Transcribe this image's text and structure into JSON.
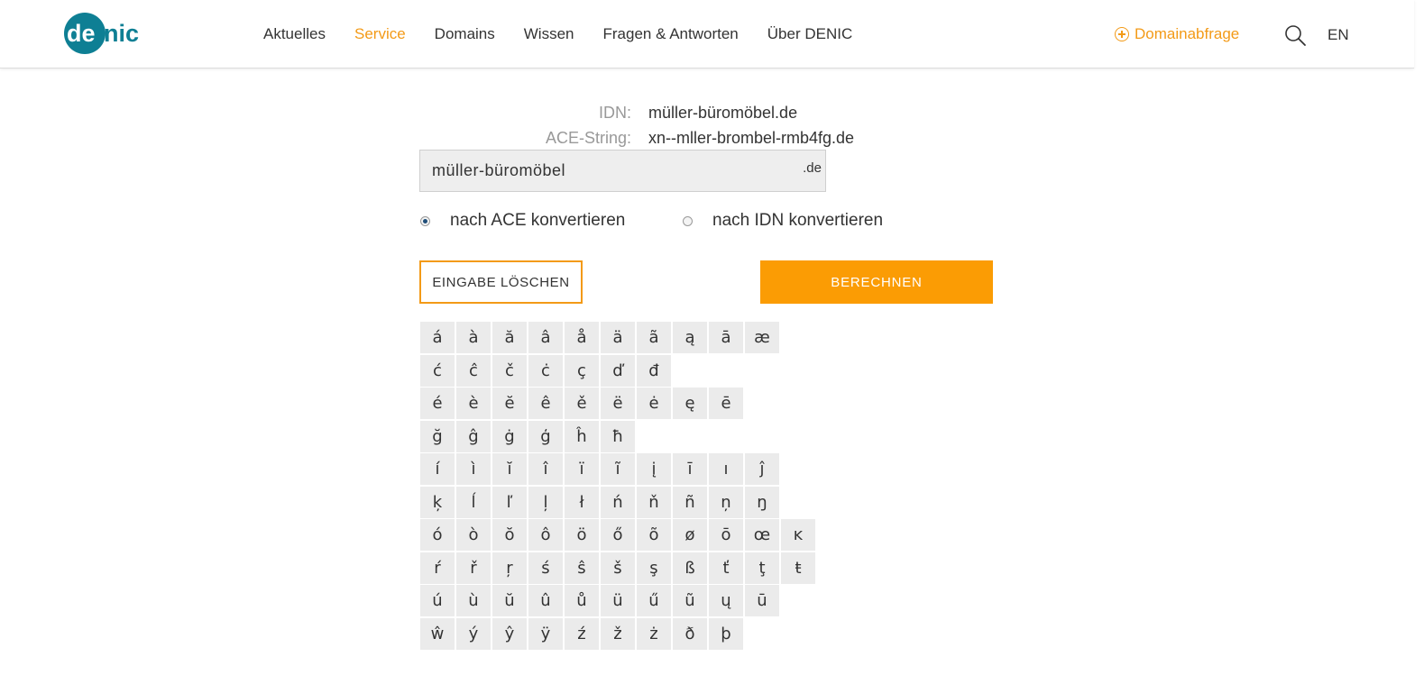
{
  "header": {
    "logo_text": "denic",
    "nav": [
      "Aktuelles",
      "Service",
      "Domains",
      "Wissen",
      "Fragen & Antworten",
      "Über DENIC"
    ],
    "active_nav": "Service",
    "domainabfrage_label": "Domainabfrage",
    "lang_label": "EN",
    "brand_color": "#0e7f94",
    "accent_color": "#f39a17"
  },
  "result": {
    "idn_label": "IDN:",
    "idn_value": "müller-büromöbel.de",
    "ace_label": "ACE-String:",
    "ace_value": "xn--mller-brombel-rmb4fg.de"
  },
  "form": {
    "input_value": "müller-büromöbel",
    "tld": ".de",
    "radio_ace": "nach ACE konvertieren",
    "radio_idn": "nach IDN konvertieren",
    "selected": "ace",
    "clear_label": "EINGABE LÖSCHEN",
    "calc_label": "BERECHNEN"
  },
  "characters": [
    [
      "á",
      "à",
      "ă",
      "â",
      "å",
      "ä",
      "ã",
      "ą",
      "ā",
      "æ"
    ],
    [
      "ć",
      "ĉ",
      "č",
      "ċ",
      "ç",
      "ď",
      "đ"
    ],
    [
      "é",
      "è",
      "ĕ",
      "ê",
      "ě",
      "ë",
      "ė",
      "ę",
      "ē"
    ],
    [
      "ğ",
      "ĝ",
      "ġ",
      "ģ",
      "ĥ",
      "ħ"
    ],
    [
      "í",
      "ì",
      "ĭ",
      "î",
      "ï",
      "ĩ",
      "į",
      "ī",
      "ı",
      "ĵ"
    ],
    [
      "ķ",
      "ĺ",
      "ľ",
      "ļ",
      "ł",
      "ń",
      "ň",
      "ñ",
      "ņ",
      "ŋ"
    ],
    [
      "ó",
      "ò",
      "ŏ",
      "ô",
      "ö",
      "ő",
      "õ",
      "ø",
      "ō",
      "œ",
      "ĸ"
    ],
    [
      "ŕ",
      "ř",
      "ŗ",
      "ś",
      "ŝ",
      "š",
      "ş",
      "ß",
      "ť",
      "ţ",
      "ŧ"
    ],
    [
      "ú",
      "ù",
      "ŭ",
      "û",
      "ů",
      "ü",
      "ű",
      "ũ",
      "ų",
      "ū"
    ],
    [
      "ŵ",
      "ý",
      "ŷ",
      "ÿ",
      "ź",
      "ž",
      "ż",
      "ð",
      "þ"
    ]
  ]
}
